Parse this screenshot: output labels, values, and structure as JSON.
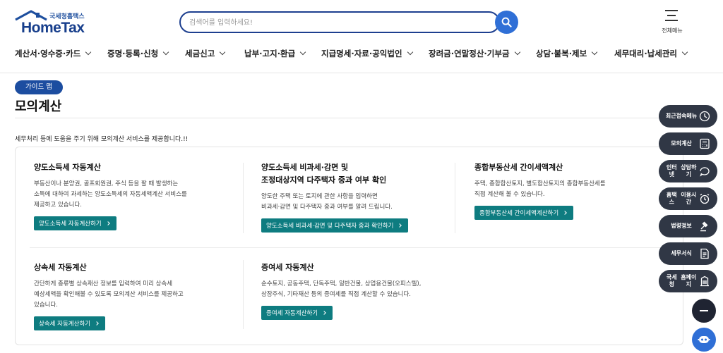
{
  "header": {
    "logo_sub": "국세청홈택스",
    "logo_main": "HomeTax",
    "search_placeholder": "검색어를 입력하세요!",
    "allmenu_label": "전체메뉴"
  },
  "gnb": [
    {
      "label": "계산서·영수증·카드"
    },
    {
      "label": "증명·등록·신청"
    },
    {
      "label": "세금신고"
    },
    {
      "label": "납부·고지·환급"
    },
    {
      "label": "지급명세·자료·공익법인"
    },
    {
      "label": "장려금·연말정산·기부금"
    },
    {
      "label": "상담·불복·제보"
    },
    {
      "label": "세무대리·납세관리"
    }
  ],
  "page": {
    "guide_button": "가이드 맵",
    "title": "모의계산",
    "intro": "세무처리 등에 도움을 주기 위해 모의계산 서비스를 제공합니다.!!"
  },
  "cards": [
    {
      "title_1": "양도소득세 자동계산",
      "desc_1": "부동산이나 분양권, 골프회원권, 주식 등을 팔 때 발생하는",
      "desc_2": "소득에 대하여 과세하는 양도소득세의 자동세액계산 서비스를",
      "desc_3": "제공하고 있습니다.",
      "button": "양도소득세 자동계산하기"
    },
    {
      "title_1": "양도소득세 비과세·감면 및",
      "title_2": "조정대상지역 다주택자 중과 여부 확인",
      "desc_1": "양도한 주택 또는 토지에 관한 사항을 입력하면",
      "desc_2": "비과세·감면 및 다주택자 중과 여부를 알려 드립니다.",
      "button": "양도소득세 비과세·감면 및 다주택자 중과 확인하기"
    },
    {
      "title_1": "종합부동산세 간이세액계산",
      "desc_1": "주택, 종합합산토지, 별도합산토지의 종합부동산세를",
      "desc_2": "직접 계산해 볼 수 있습니다.",
      "button": "종합부동산세 간이세액계산하기"
    },
    {
      "title_1": "상속세 자동계산",
      "desc_1": "간단하게 종류별 상속재산 정보를 입력하여 미리 상속세",
      "desc_2": "예상세액을 확인해볼 수 있도록 모의계산 서비스를 제공하고",
      "desc_3": "있습니다.",
      "button": "상속세 자동계산하기"
    },
    {
      "title_1": "증여세 자동계산",
      "desc_1": "순수토지, 공동주택, 단독주택, 일반건물, 상업용건물(오피스텔),",
      "desc_2": "상장주식, 기타재산 등의 증여세를 직접 계산할 수 있습니다.",
      "button": "증여세 자동계산하기"
    }
  ],
  "quick_menu": [
    {
      "line1": "최근",
      "line2": "접속메뉴",
      "icon": "clock-icon"
    },
    {
      "line1": "모의계산",
      "line2": "",
      "icon": "calculator-icon"
    },
    {
      "line1": "인터넷",
      "line2": "상담하기",
      "icon": "chat-icon"
    },
    {
      "line1": "홈택스",
      "line2": "이용시간",
      "icon": "alarm-clock-icon"
    },
    {
      "line1": "법령정보",
      "line2": "",
      "icon": "gavel-icon"
    },
    {
      "line1": "세무서식",
      "line2": "",
      "icon": "document-icon"
    },
    {
      "line1": "국세청",
      "line2": "홈페이지",
      "icon": "building-icon"
    }
  ],
  "colors": {
    "brand_navy": "#1c4da0",
    "search_blue": "#2f6fd6",
    "card_button_teal": "#0e7c80",
    "quick_menu_dark": "#303745"
  }
}
